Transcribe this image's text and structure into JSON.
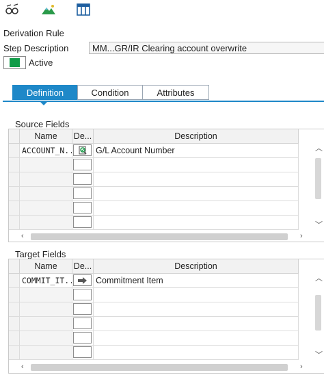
{
  "toolbar": {
    "buttons": [
      {
        "icon": "glasses-pencil-icon"
      },
      {
        "icon": "mountain-icon"
      },
      {
        "icon": "table-columns-icon"
      }
    ]
  },
  "form": {
    "derivation_rule_label": "Derivation Rule",
    "step_description_label": "Step Description",
    "step_description_value": "MM...GR/IR Clearing account overwrite",
    "active_label": "Active",
    "active_color": "#119c48"
  },
  "tabs": [
    {
      "label": "Definition",
      "selected": true
    },
    {
      "label": "Condition",
      "selected": false
    },
    {
      "label": "Attributes",
      "selected": false
    }
  ],
  "source_fields": {
    "title": "Source Fields",
    "columns": {
      "name": "Name",
      "de": "De...",
      "description": "Description"
    },
    "rows": [
      {
        "name": "ACCOUNT_N...",
        "description": "G/L Account Number",
        "de_icon": "check-magnifier-icon"
      }
    ]
  },
  "target_fields": {
    "title": "Target Fields",
    "columns": {
      "name": "Name",
      "de": "De...",
      "description": "Description"
    },
    "rows": [
      {
        "name": "COMMIT_IT...",
        "description": "Commitment Item",
        "de_icon": "arrow-right-icon"
      }
    ]
  },
  "colors": {
    "accent": "#1e88c8"
  }
}
